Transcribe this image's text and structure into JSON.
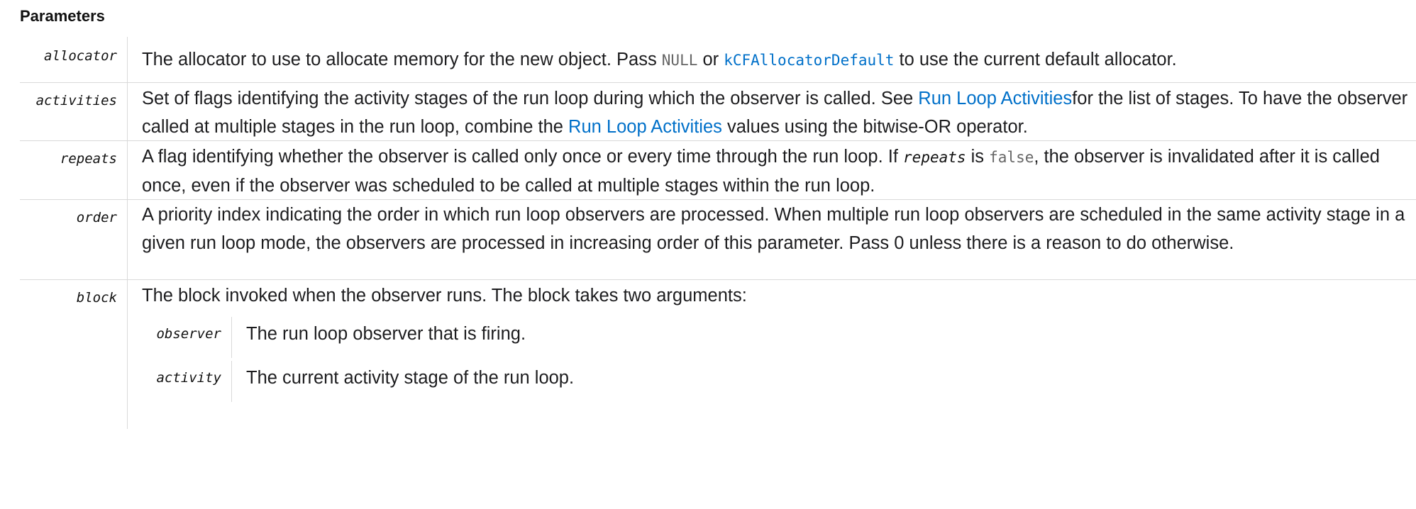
{
  "heading": "Parameters",
  "params": {
    "allocator": {
      "name": "allocator",
      "t1": "The allocator to use to allocate memory for the new object. Pass ",
      "c1": "NULL",
      "t2": " or ",
      "c2": "kCFAllocatorDefault",
      "t3": " to use the current default allocator."
    },
    "activities": {
      "name": "activities",
      "t1": "Set of flags identifying the activity stages of the run loop during which the observer is called. See ",
      "l1": "Run Loop Activities",
      "t2": "for the list of stages. To have the observer called at multiple stages in the run loop, combine the ",
      "l2": "Run Loop Activities",
      "t3": " values using the bitwise-OR operator."
    },
    "repeats": {
      "name": "repeats",
      "t1": "A flag identifying whether the observer is called only once or every time through the run loop. If ",
      "c1": "repeats",
      "t2": " is ",
      "c2": "false",
      "t3": ", the observer is invalidated after it is called once, even if the observer was scheduled to be called at multiple stages within the run loop."
    },
    "order": {
      "name": "order",
      "t1": "A priority index indicating the order in which run loop observers are processed. When multiple run loop observers are scheduled in the same activity stage in a given run loop mode, the observers are processed in increasing order of this parameter. Pass 0 unless there is a reason to do otherwise."
    },
    "block": {
      "name": "block",
      "t1": "The block invoked when the observer runs. The block takes two arguments:",
      "sub": [
        {
          "name": "observer",
          "desc": "The run loop observer that is firing."
        },
        {
          "name": "activity",
          "desc": "The current activity stage of the run loop."
        }
      ]
    }
  }
}
